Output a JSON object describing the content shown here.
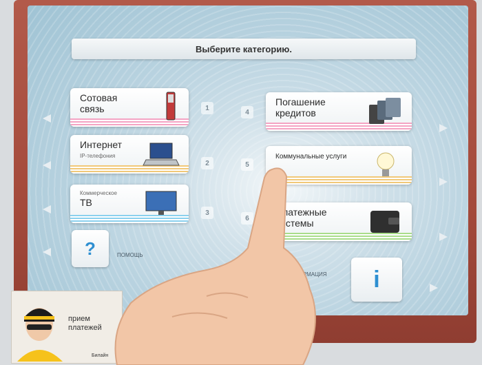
{
  "screen": {
    "title": "Выберите категорию."
  },
  "categories": [
    {
      "num": "1",
      "label": "Сотовая связь",
      "sub": "",
      "icon": "mobile-phone-icon"
    },
    {
      "num": "2",
      "label": "Интернет",
      "sub": "IP-телефония",
      "icon": "laptop-icon"
    },
    {
      "num": "3",
      "label": "ТВ",
      "sub": "Коммерческое",
      "icon": "tv-icon"
    },
    {
      "num": "4",
      "label": "Погашение кредитов",
      "sub": "",
      "icon": "credit-cards-icon"
    },
    {
      "num": "5",
      "label": "Коммунальные услуги",
      "sub": "",
      "icon": "lightbulb-icon"
    },
    {
      "num": "6",
      "label": "Платежные системы",
      "sub": "",
      "icon": "wallet-icon"
    }
  ],
  "help": {
    "symbol": "?",
    "label": "ПОМОЩЬ"
  },
  "info": {
    "symbol": "i",
    "label": "ИНФОРМАЦИЯ"
  },
  "ad": {
    "text": "прием платежей",
    "brand": "Билайн"
  },
  "colors": {
    "bezel": "#a44a3b",
    "accent": "#2e8fd1"
  }
}
